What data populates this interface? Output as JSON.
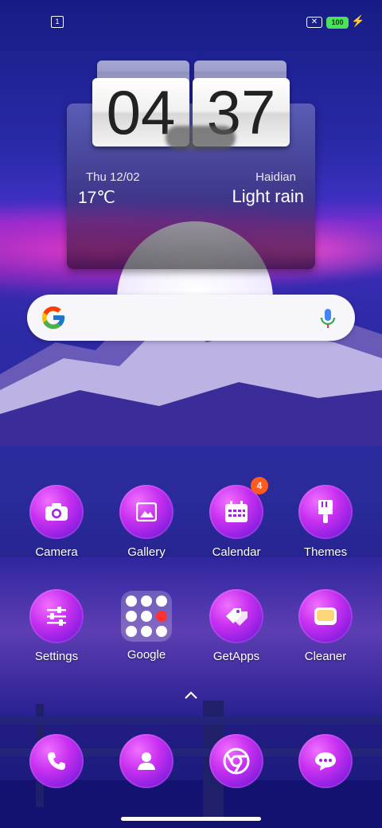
{
  "status_bar": {
    "sim_icon": "sim-1-icon",
    "no_sim_icon": "no-sim-icon",
    "battery": "100",
    "charging_icon": "bolt-icon"
  },
  "widget": {
    "hour": "04",
    "minute": "37",
    "date": "Thu  12/02",
    "city": "Haidian",
    "temperature": "17℃",
    "condition": "Light rain"
  },
  "search": {
    "logo_icon": "google-g-icon",
    "mic_icon": "microphone-icon"
  },
  "apps_row1": [
    {
      "label": "Camera",
      "icon": "camera-icon"
    },
    {
      "label": "Gallery",
      "icon": "image-icon"
    },
    {
      "label": "Calendar",
      "icon": "calendar-icon",
      "badge": "4"
    },
    {
      "label": "Themes",
      "icon": "paintbrush-icon"
    }
  ],
  "apps_row2": [
    {
      "label": "Settings",
      "icon": "sliders-icon"
    },
    {
      "label": "Google",
      "icon": "folder-icon"
    },
    {
      "label": "GetApps",
      "icon": "tags-icon"
    },
    {
      "label": "Cleaner",
      "icon": "cleaner-icon"
    }
  ],
  "dock": [
    {
      "icon": "phone-icon"
    },
    {
      "icon": "contacts-icon"
    },
    {
      "icon": "chrome-icon"
    },
    {
      "icon": "messages-icon"
    }
  ],
  "colors": {
    "icon_gradient": "#c830f0",
    "badge": "#ff5a1f",
    "battery": "#49e25a"
  }
}
